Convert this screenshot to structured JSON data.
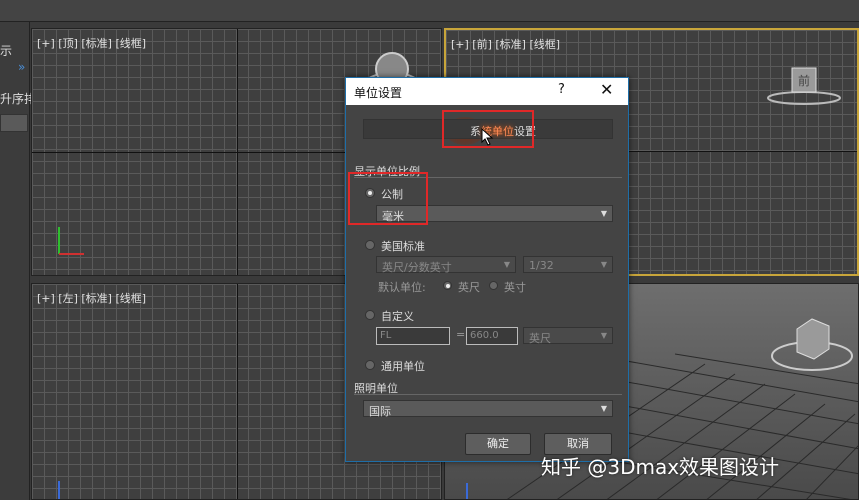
{
  "left_panel": {
    "label_1": "示",
    "label_2": "升序排",
    "arrow": "»"
  },
  "viewports": {
    "top_left": "[+] [顶] [标准] [线框]",
    "top_right": "[+] [前] [标准] [线框]",
    "bottom_left": "[+] [左] [标准] [线框]"
  },
  "viewcube": {
    "front_face": "前"
  },
  "dialog": {
    "title": "单位设置",
    "help": "?",
    "close": "✕",
    "system_unit_button_prefix": "系",
    "system_unit_button_highlight": "統单位",
    "system_unit_button_suffix": "设置",
    "display_scale_section": "显示单位比例",
    "metric": {
      "label": "公制",
      "selected": true,
      "unit_value": "毫米"
    },
    "us_standard": {
      "label": "美国标准",
      "unit_value": "英尺/分数英寸",
      "fraction_value": "1/32",
      "default_unit_label": "默认单位:",
      "option_feet": "英尺",
      "option_inches": "英寸"
    },
    "custom": {
      "label": "自定义",
      "name_value": "FL",
      "equals": "=",
      "amount_value": "660.0",
      "unit_value": "英尺"
    },
    "generic": {
      "label": "通用单位"
    },
    "lighting_section": "照明单位",
    "lighting_value": "国际",
    "ok_button": "确定",
    "cancel_button": "取消"
  },
  "watermark": "知乎 @3Dmax效果图设计"
}
